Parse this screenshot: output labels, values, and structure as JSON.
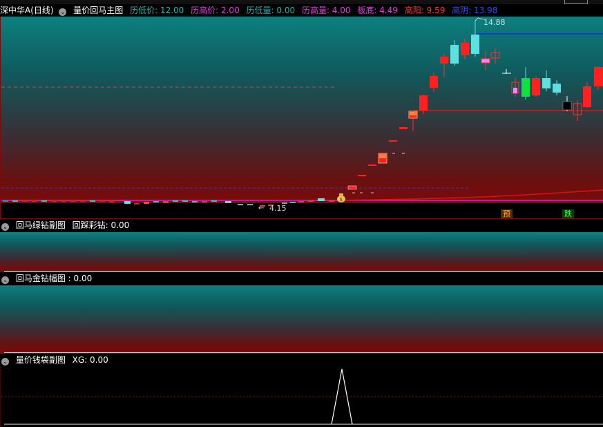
{
  "top_strip_partial": "— —   — —   — — — — —",
  "main_header": {
    "stock": "深中华A(日线)",
    "icon": "chevron-down-icon",
    "indicator": "量价回马主图",
    "fields": [
      {
        "label": "历低价: 12.00",
        "color": "#1fb0b0"
      },
      {
        "label": "历高价: 2.00",
        "color": "#e23ae0"
      },
      {
        "label": "历低量: 0.00",
        "color": "#1fb0b0"
      },
      {
        "label": "历高量: 4.00",
        "color": "#e23ae0"
      },
      {
        "label": "板底: 4.49",
        "color": "#e23ae0"
      },
      {
        "label": "高阳: 9.59",
        "color": "#ff3030"
      },
      {
        "label": "高阴: 13.98",
        "color": "#2a4df0"
      }
    ]
  },
  "main_chart": {
    "high_label": "14.88",
    "low_label": "4.15",
    "signal_pre": "预",
    "signal_fall": "跌"
  },
  "panel2": {
    "title": "回马绿钻副图",
    "field": "回踩彩钻: 0.00"
  },
  "panel3": {
    "title": "回马金钻幅图 : 0.00"
  },
  "panel4": {
    "title": "量价钱袋副图",
    "field": "XG: 0.00"
  }
}
